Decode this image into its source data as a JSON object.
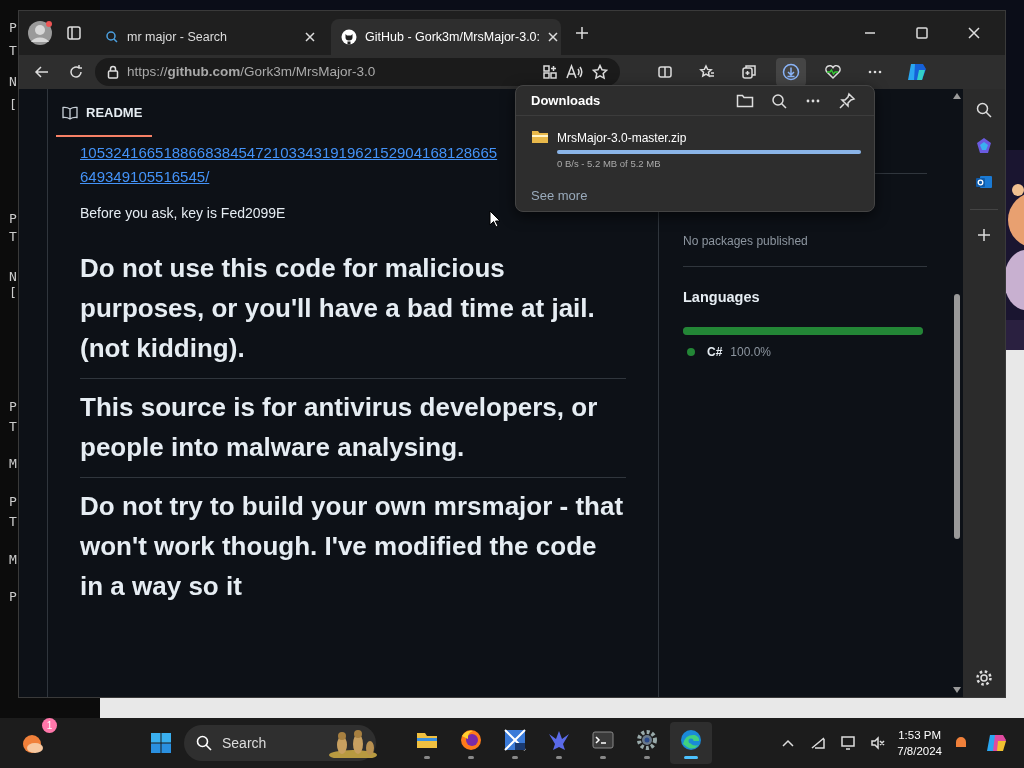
{
  "terminal": {
    "lines": [
      "P",
      "T",
      "N",
      "[",
      "P",
      "T",
      "N",
      "[",
      "P",
      "T",
      "M",
      "P",
      "T",
      "M",
      "P"
    ]
  },
  "browser": {
    "tabs": [
      {
        "title": "mr major - Search",
        "kind": "search",
        "selected": false
      },
      {
        "title": "GitHub - Gork3m/MrsMajor-3.0:",
        "kind": "github",
        "selected": true
      }
    ],
    "address": "https://**github.com**/Gork3m/MrsMajor-3.0",
    "downloads_button": {
      "selected": true
    }
  },
  "readme": {
    "title": "README",
    "links": [
      "10532416651886683845472103343191962152904168128665",
      "649349105516545/"
    ],
    "paragraph": "Before you ask, key is Fed2099E",
    "headings": [
      "Do not use this code for malicious purposes, or you'll have a bad time at jail. (not kidding).",
      "This source is for antivirus developers, or people into malware analysing.",
      "Do not try to build your own mrsmajor - that won't work though. I've modified the code in a way so it"
    ]
  },
  "sidebar": {
    "packages": "No packages published",
    "languages_title": "Languages",
    "languages": [
      {
        "name": "C#",
        "percent": "100.0%",
        "color": "#238636",
        "level": 1.0
      }
    ]
  },
  "downloads": {
    "title": "Downloads",
    "items": [
      {
        "name": "MrsMajor-3.0-master.zip",
        "status": "0 B/s - 5.2 MB of 5.2 MB",
        "level": 1.0
      }
    ],
    "see_more": "See more"
  },
  "taskbar": {
    "notification_count": "1",
    "search_placeholder": "Search",
    "apps": [
      {
        "kind": "files",
        "selected": false
      },
      {
        "kind": "firefox",
        "selected": false
      },
      {
        "kind": "xp",
        "selected": false
      },
      {
        "kind": "bird",
        "selected": false
      },
      {
        "kind": "terminal",
        "selected": false
      },
      {
        "kind": "settings",
        "selected": false
      },
      {
        "kind": "edge",
        "selected": true
      }
    ],
    "time": "1:53 PM",
    "date": "7/8/2024"
  }
}
